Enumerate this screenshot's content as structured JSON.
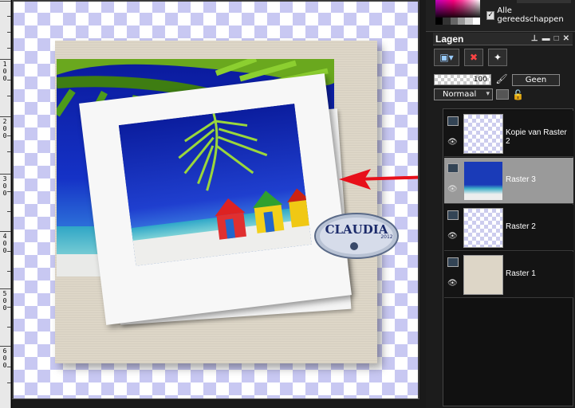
{
  "ruler": {
    "labels": [
      {
        "digits": [
          "1",
          "0",
          "0"
        ]
      },
      {
        "digits": [
          "2",
          "0",
          "0"
        ]
      },
      {
        "digits": [
          "3",
          "0",
          "0"
        ]
      },
      {
        "digits": [
          "4",
          "0",
          "0"
        ]
      },
      {
        "digits": [
          "5",
          "0",
          "0"
        ]
      },
      {
        "digits": [
          "6",
          "0",
          "0"
        ]
      }
    ]
  },
  "canvas": {
    "watermark_text": "CLAUDIA",
    "watermark_sub": "2012"
  },
  "right_panel": {
    "all_tools_label": "Alle gereedschappen",
    "all_tools_checked": "✓"
  },
  "layers_panel": {
    "title": "Lagen",
    "opacity_value": "100",
    "mask_label": "Geen",
    "blend_mode": "Normaal",
    "layers": [
      {
        "name": "Kopie van Raster 2",
        "selected": false
      },
      {
        "name": "Raster 3",
        "selected": true
      },
      {
        "name": "Raster 2",
        "selected": false
      },
      {
        "name": "Raster 1",
        "selected": false
      }
    ]
  },
  "colors": {
    "checker": "#c8c8f2",
    "paper": "#ddd6c7",
    "arrow": "#e8101a",
    "selected_layer": "#9a9a9a"
  }
}
